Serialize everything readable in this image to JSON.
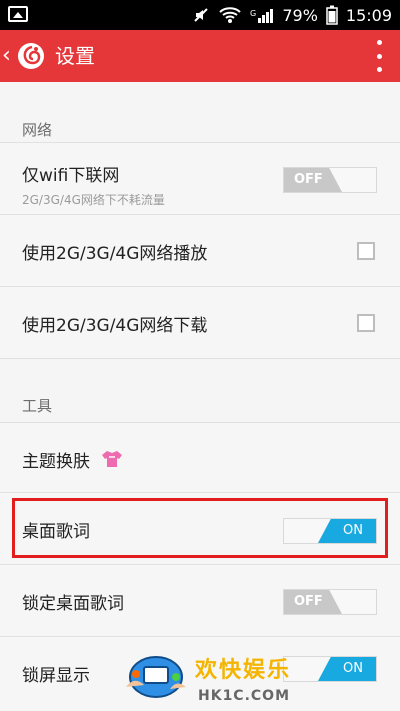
{
  "statusbar": {
    "battery": "79%",
    "time": "15:09"
  },
  "appbar": {
    "title": "设置"
  },
  "sections": {
    "network": "网络",
    "tools": "工具"
  },
  "rows": {
    "wifi_only": {
      "label": "仅wifi下联网",
      "sub": "2G/3G/4G网络下不耗流量",
      "toggle": "OFF"
    },
    "play_mobile": {
      "label": "使用2G/3G/4G网络播放"
    },
    "download_mobile": {
      "label": "使用2G/3G/4G网络下载"
    },
    "theme": {
      "label": "主题换肤"
    },
    "desktop_lyrics": {
      "label": "桌面歌词",
      "toggle": "ON"
    },
    "lock_desktop_lyrics": {
      "label": "锁定桌面歌词",
      "toggle": "OFF"
    },
    "lockscreen": {
      "label": "锁屏显示",
      "toggle": "ON"
    }
  },
  "watermark": {
    "cn": "欢快娱乐",
    "en": "HK1C.COM"
  },
  "colors": {
    "appbar": "#e5363a",
    "toggle_on": "#18a9e0",
    "toggle_off": "#c8c8c8",
    "highlight": "#e11d1d"
  },
  "icons": {
    "gallery": "image-icon",
    "mute": "mute-icon",
    "wifi": "wifi-icon",
    "signal": "signal-icon",
    "battery": "battery-icon",
    "back": "chevron-left-icon",
    "logo": "netease-music-logo",
    "more": "more-vert-icon",
    "theme": "tshirt-icon"
  }
}
